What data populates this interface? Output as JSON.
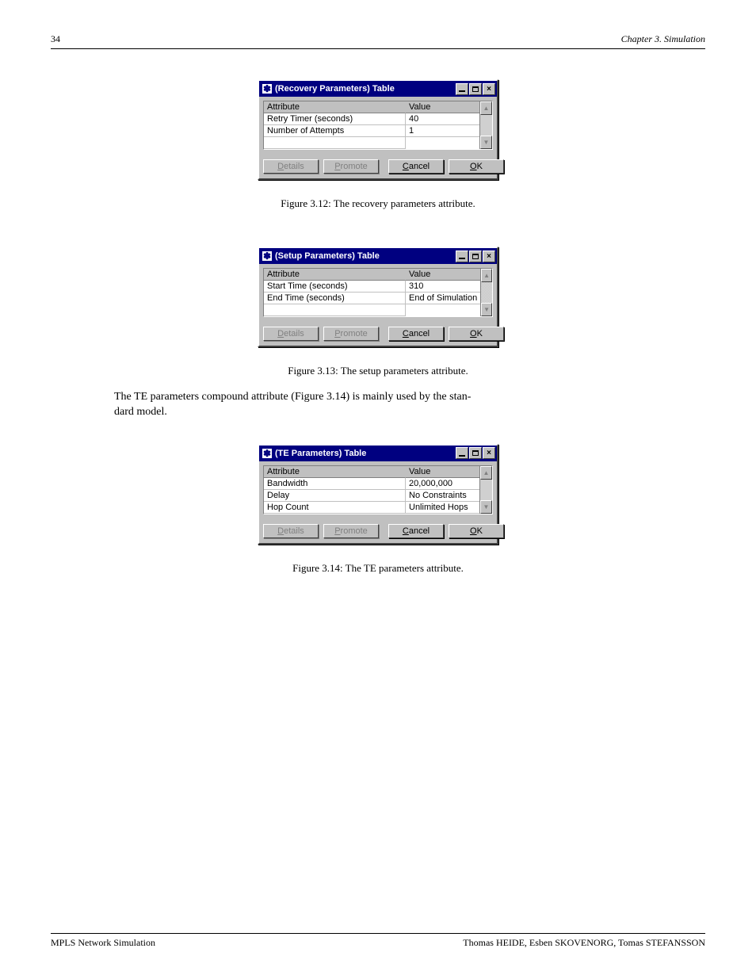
{
  "header": {
    "left": "34",
    "right": "Chapter 3. Simulation"
  },
  "footer": {
    "left": "MPLS Network Simulation",
    "right": "Thomas HEIDE, Esben SKOVENORG, Tomas STEFANSSON"
  },
  "captions": {
    "fig312": "Figure 3.12: The recovery parameters attribute.",
    "fig313": "Figure 3.13: The setup parameters attribute.",
    "fig314": "Figure 3.14: The TE parameters attribute."
  },
  "para1": "The TE parameters compound attribute (Figure 3.14) is mainly used by the stan-",
  "para2": "dard model.",
  "buttons": {
    "details": "Details",
    "promote": "Promote",
    "cancel": "Cancel",
    "ok": "OK"
  },
  "headers": {
    "attr": "Attribute",
    "val": "Value"
  },
  "dialog1": {
    "title": "(Recovery Parameters) Table",
    "rows": [
      {
        "attr": "Retry Timer (seconds)",
        "val": "40"
      },
      {
        "attr": "Number of Attempts",
        "val": "1"
      }
    ]
  },
  "dialog2": {
    "title": "(Setup Parameters) Table",
    "rows": [
      {
        "attr": "Start Time (seconds)",
        "val": "310"
      },
      {
        "attr": "End Time (seconds)",
        "val": "End of Simulation"
      }
    ]
  },
  "dialog3": {
    "title": "(TE Parameters) Table",
    "rows": [
      {
        "attr": "Bandwidth",
        "val": "20,000,000"
      },
      {
        "attr": "Delay",
        "val": "No Constraints"
      },
      {
        "attr": "Hop Count",
        "val": "Unlimited Hops"
      }
    ]
  }
}
